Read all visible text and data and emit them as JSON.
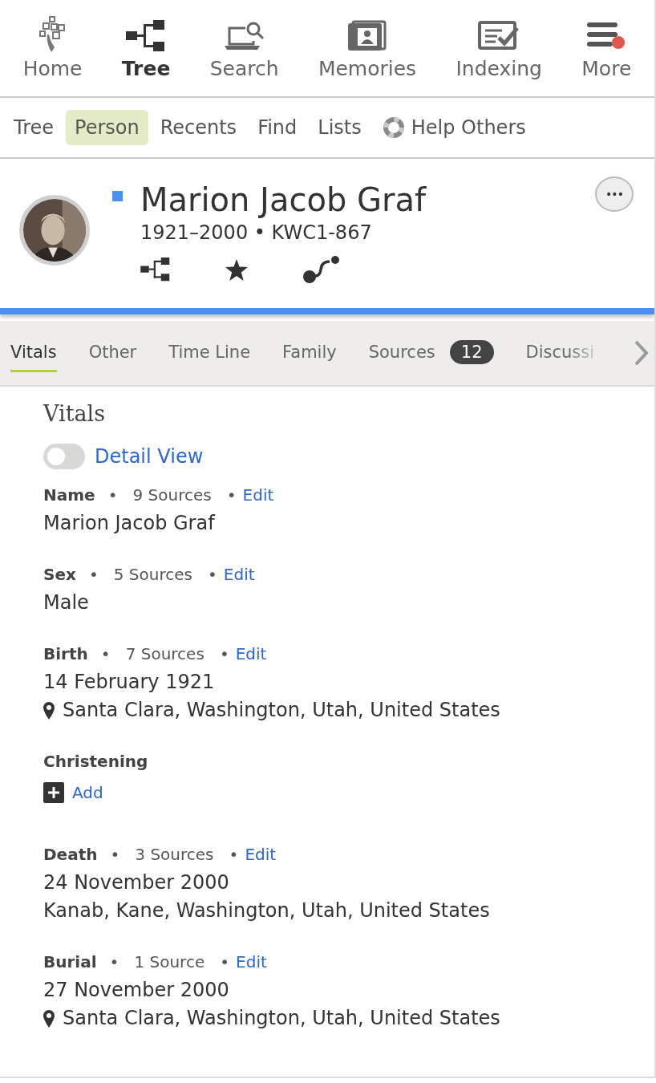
{
  "main_nav": [
    {
      "label": "Home",
      "selected": false
    },
    {
      "label": "Tree",
      "selected": true
    },
    {
      "label": "Search",
      "selected": false
    },
    {
      "label": "Memories",
      "selected": false
    },
    {
      "label": "Indexing",
      "selected": false
    },
    {
      "label": "More",
      "selected": false
    }
  ],
  "sub_nav": [
    {
      "kind": "plain",
      "label": "Tree",
      "selected": false
    },
    {
      "kind": "plain",
      "label": "Person",
      "selected": true
    },
    {
      "kind": "plain",
      "label": "Recents",
      "selected": false
    },
    {
      "kind": "plain",
      "label": "Find",
      "selected": false
    },
    {
      "kind": "plain",
      "label": "Lists",
      "selected": false
    },
    {
      "kind": "with-icon",
      "label": "Help Others",
      "selected": false
    }
  ],
  "person": {
    "name": "Marion Jacob Graf",
    "summary": "1921–2000 • KWC1-867",
    "more_button": "•••"
  },
  "detail_tabs": [
    {
      "label": "Vitals",
      "selected": true
    },
    {
      "label": "Other",
      "selected": false
    },
    {
      "label": "Time Line",
      "selected": false
    },
    {
      "label": "Family",
      "selected": false
    },
    {
      "label": "Sources",
      "selected": false,
      "badge": "12"
    },
    {
      "label": "Discussi",
      "selected": false
    }
  ],
  "vitals": {
    "title": "Vitals",
    "toggle": {
      "label": "Detail View",
      "on": false
    },
    "facts": [
      {
        "kind": "fact",
        "label": "Name",
        "sources": "•   9 Sources   •",
        "action": "Edit",
        "lines": [
          {
            "kind": "text",
            "text": "Marion Jacob Graf"
          }
        ]
      },
      {
        "kind": "fact",
        "label": "Sex",
        "sources": "•   5 Sources   •",
        "action": "Edit",
        "lines": [
          {
            "kind": "text",
            "text": "Male"
          }
        ]
      },
      {
        "kind": "fact",
        "label": "Birth",
        "sources": "•   7 Sources   •",
        "action": "Edit",
        "lines": [
          {
            "kind": "text",
            "text": "14 February 1921"
          },
          {
            "kind": "place",
            "text": "Santa Clara, Washington, Utah, United States"
          }
        ]
      },
      {
        "kind": "empty",
        "label": "Christening",
        "action": "Add"
      },
      {
        "kind": "fact",
        "label": "Death",
        "sources": "•   3 Sources   •",
        "action": "Edit",
        "lines": [
          {
            "kind": "text",
            "text": "24 November 2000"
          },
          {
            "kind": "text",
            "text": "Kanab, Kane, Washington, Utah, United States"
          }
        ]
      },
      {
        "kind": "fact",
        "label": "Burial",
        "sources": "•   1 Source   •",
        "action": "Edit",
        "lines": [
          {
            "kind": "text",
            "text": "27 November 2000"
          },
          {
            "kind": "place",
            "text": "Santa Clara, Washington, Utah, United States"
          }
        ]
      }
    ]
  }
}
